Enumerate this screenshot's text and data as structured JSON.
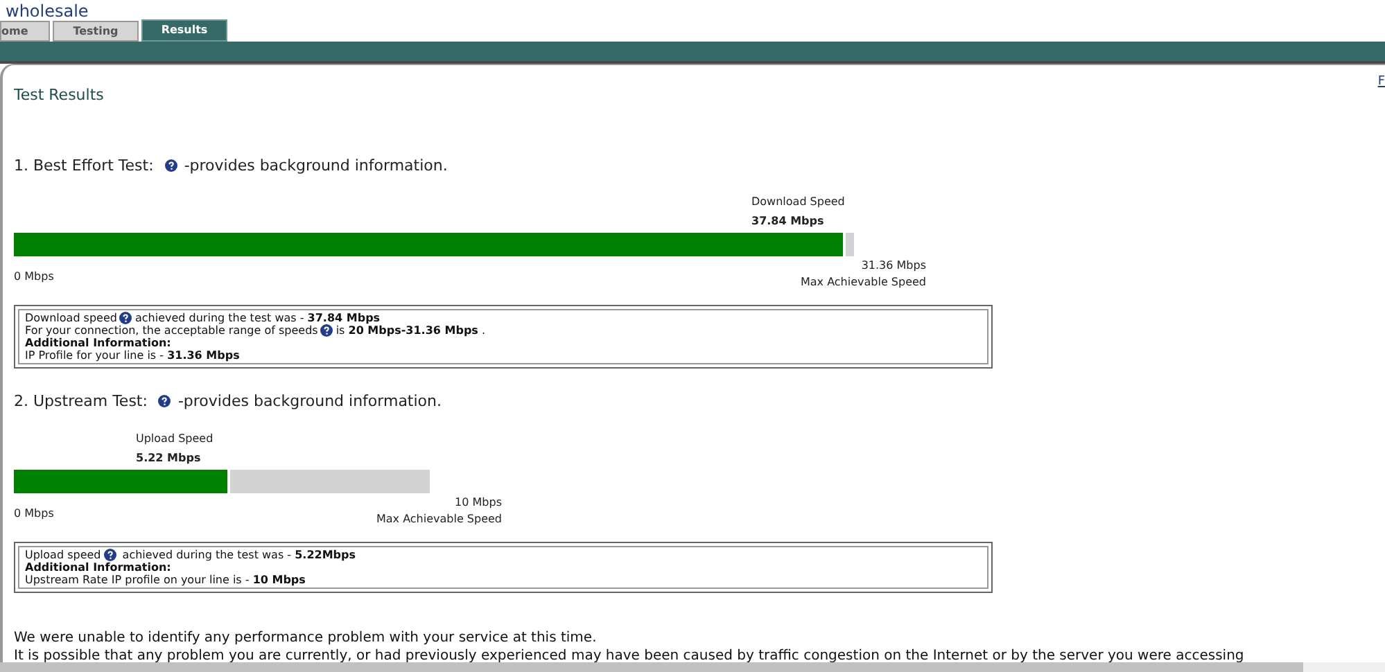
{
  "logo": {
    "text": "wholesale"
  },
  "tabs": [
    {
      "label": "ome",
      "selected": false
    },
    {
      "label": "Testing",
      "selected": false
    },
    {
      "label": "Results",
      "selected": true
    }
  ],
  "page_title": "Test Results",
  "side_link": "F",
  "tests": [
    {
      "heading": "1. Best Effort Test:",
      "heading_note": "-provides background information.",
      "speed_label": "Download Speed",
      "speed_value": "37.84 Mbps",
      "level": 0.99,
      "min_label": "0 Mbps",
      "max_value": "31.36 Mbps",
      "max_label": "Max Achievable Speed",
      "info_lines": [
        {
          "kind": "help",
          "before": "Download speed",
          "after": "achieved during the test was - **37.84 Mbps**"
        },
        {
          "kind": "help",
          "before": "For your connection, the acceptable range of speeds",
          "after": "is **20 Mbps-31.36 Mbps** ."
        },
        {
          "kind": "bold",
          "text": "Additional Information:"
        },
        {
          "kind": "plain",
          "text": "IP Profile for your line is - **31.36 Mbps**"
        }
      ]
    },
    {
      "heading": "2. Upstream Test:",
      "heading_note": "-provides background information.",
      "speed_label": "Upload Speed",
      "speed_value": "5.22 Mbps",
      "level": 0.52,
      "min_label": "0 Mbps",
      "max_value": "10 Mbps",
      "max_label": "Max Achievable Speed",
      "info_lines": [
        {
          "kind": "help",
          "before": "Upload speed",
          "after": " achieved during the test was - **5.22Mbps**"
        },
        {
          "kind": "bold",
          "text": "Additional Information:"
        },
        {
          "kind": "plain",
          "text": "Upstream Rate IP profile on your line is - **10 Mbps**"
        }
      ]
    }
  ],
  "summary": [
    "We were unable to identify any performance problem with your service at this time.",
    "It is possible that any problem you are currently, or had previously experienced may have been caused by traffic congestion on the Internet or by the server you were accessing"
  ]
}
